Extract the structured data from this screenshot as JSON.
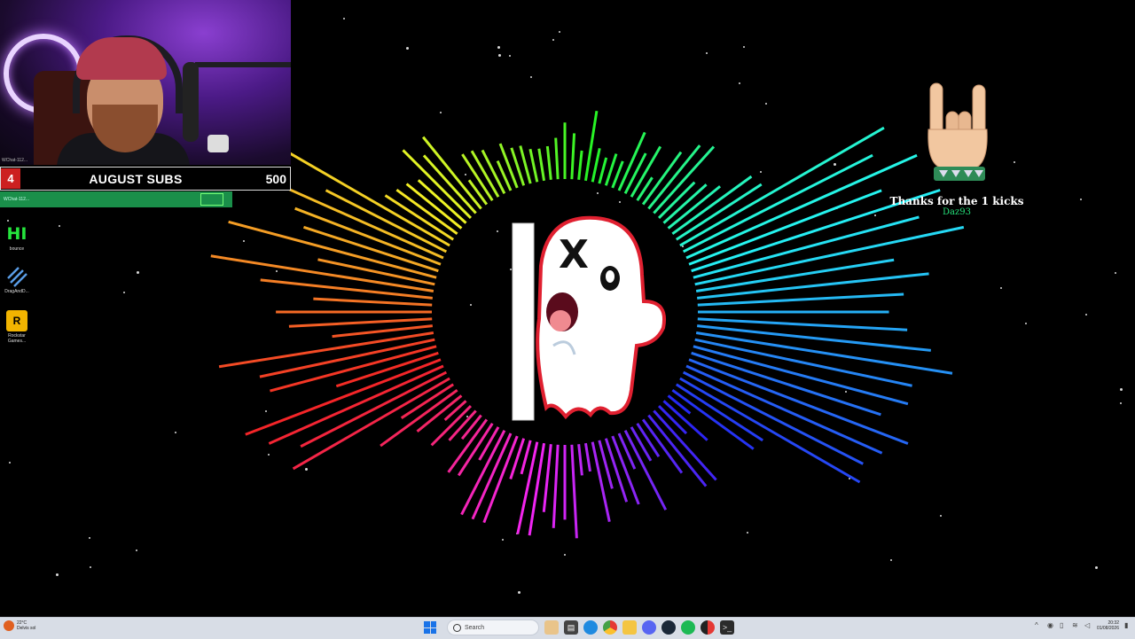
{
  "webcam": {
    "label": "webcam-feed",
    "small_caption": "WChat-112..."
  },
  "subs_bar": {
    "count": "4",
    "title": "AUGUST SUBS",
    "goal": "500"
  },
  "chat_strip": {
    "text": "WChat-112..."
  },
  "desktop_icons": [
    {
      "label": "bounce",
      "icon": "hi-icon"
    },
    {
      "label": "DragAndD...",
      "icon": "stripes-icon"
    },
    {
      "label": "Rockstar Games...",
      "icon": "rockstar-icon"
    }
  ],
  "kicks_alert": {
    "message": "Thanks for the 1 kicks",
    "username": "Daz93",
    "icon": "rock-hand-icon"
  },
  "visualizer": {
    "center_icon": "ghost-logo-icon"
  },
  "taskbar": {
    "weather_temp": "22°C",
    "weather_desc": "Delvis sol",
    "search_placeholder": "Search",
    "time": "20:32",
    "date": "01/08/2026",
    "apps": [
      "file-explorer-icon",
      "folder-icon",
      "edge-icon",
      "chrome-icon",
      "files-icon",
      "discord-icon",
      "steam-icon",
      "spotify-icon",
      "chrome-red-icon",
      "terminal-icon"
    ]
  },
  "colors": {
    "subs_count_bg": "#cc2020",
    "chat_strip_bg": "#1a8f4a",
    "kicks_username": "#25e07a",
    "taskbar_bg": "#d8dde6"
  }
}
